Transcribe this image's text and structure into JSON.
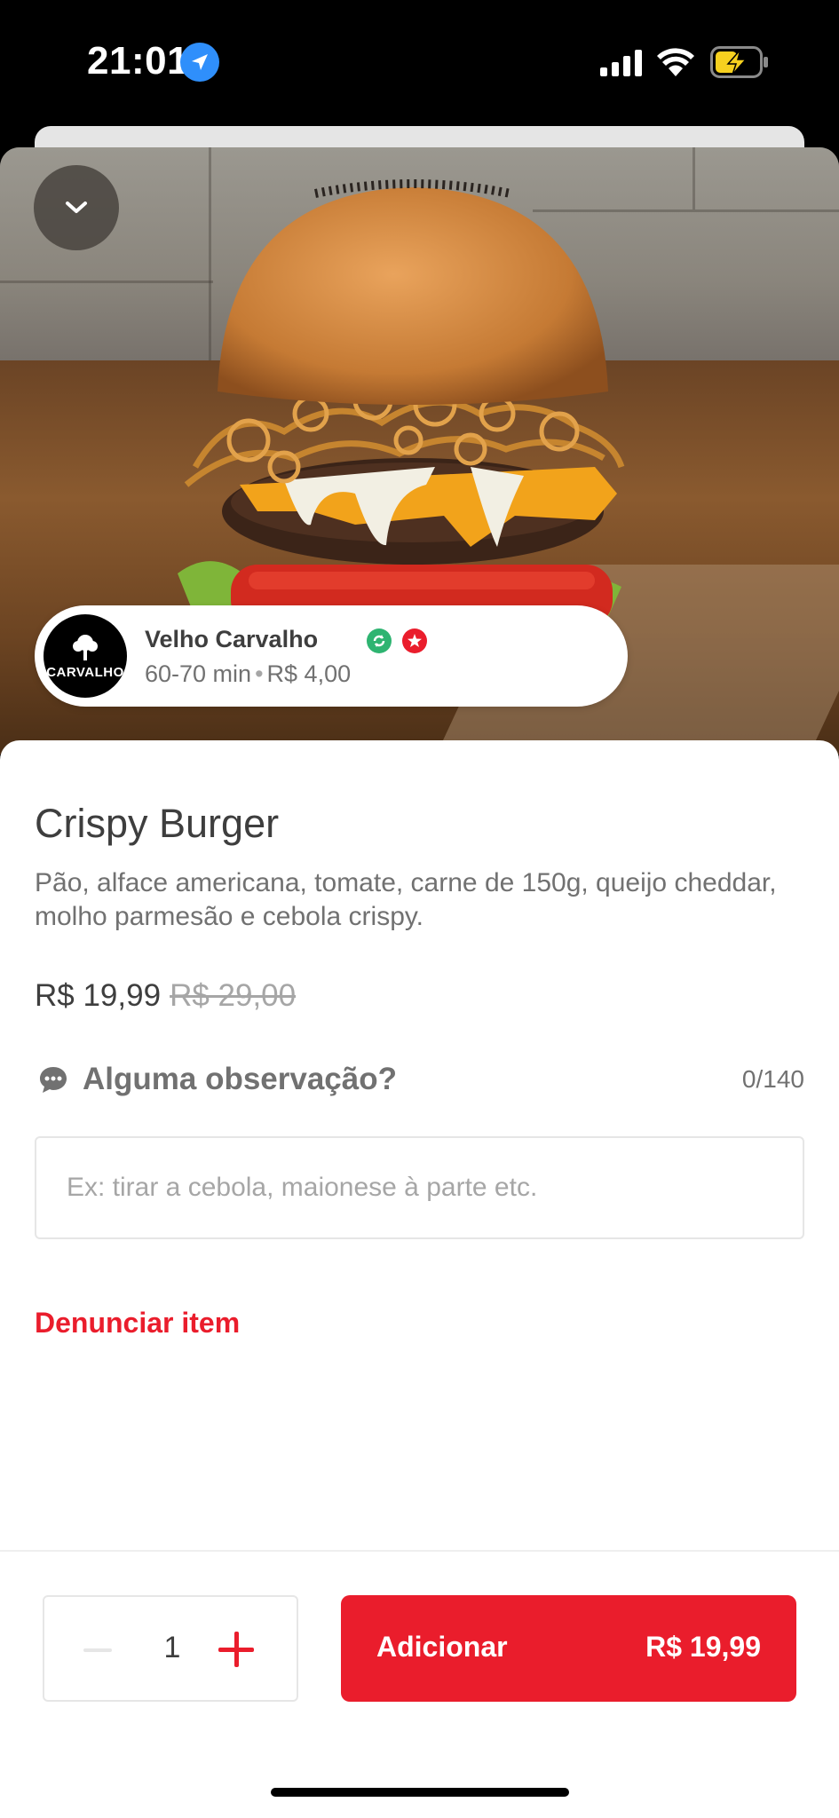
{
  "status_bar": {
    "time": "21:01",
    "icons": [
      "location-arrow-icon",
      "cellular-signal-icon",
      "wifi-icon",
      "battery-charging-icon"
    ]
  },
  "hero": {
    "image": "burger-photo",
    "back_icon": "chevron-down-icon"
  },
  "restaurant": {
    "name": "Velho Carvalho",
    "logo_text": "CARVALHO",
    "delivery_time": "60-70 min",
    "separator": "•",
    "delivery_fee": "R$ 4,00",
    "badges": [
      "refresh-badge-icon",
      "super-restaurant-badge-icon"
    ]
  },
  "item": {
    "title": "Crispy Burger",
    "description": "Pão, alface americana, tomate, carne de 150g, queijo cheddar, molho parmesão e cebola crispy.",
    "price": "R$ 19,99",
    "original_price": "R$ 29,00"
  },
  "observation": {
    "label": "Alguma observação?",
    "counter": "0/140",
    "placeholder": "Ex: tirar a cebola, maionese à parte etc.",
    "value": ""
  },
  "report_label": "Denunciar item",
  "cart": {
    "quantity": "1",
    "add_label": "Adicionar",
    "add_price": "R$ 19,99"
  },
  "colors": {
    "brand_red": "#ea1d2c",
    "text_dark": "#3e3e3e",
    "text_muted": "#717171",
    "badge_green": "#2eb471"
  }
}
